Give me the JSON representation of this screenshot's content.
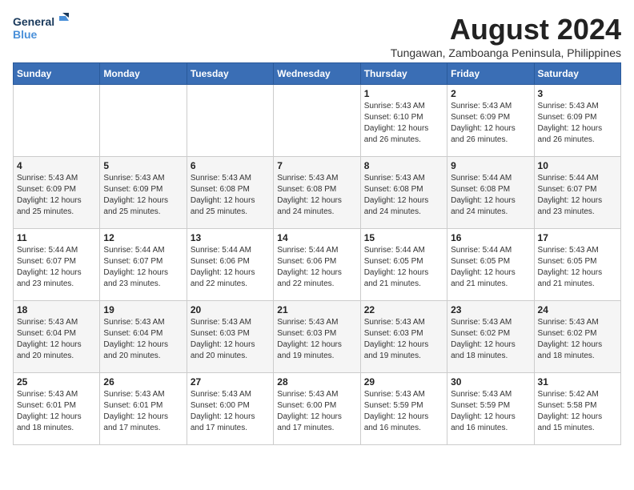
{
  "logo": {
    "line1": "General",
    "line2": "Blue"
  },
  "title": "August 2024",
  "location": "Tungawan, Zamboanga Peninsula, Philippines",
  "days_header": [
    "Sunday",
    "Monday",
    "Tuesday",
    "Wednesday",
    "Thursday",
    "Friday",
    "Saturday"
  ],
  "weeks": [
    [
      {
        "day": "",
        "info": ""
      },
      {
        "day": "",
        "info": ""
      },
      {
        "day": "",
        "info": ""
      },
      {
        "day": "",
        "info": ""
      },
      {
        "day": "1",
        "info": "Sunrise: 5:43 AM\nSunset: 6:10 PM\nDaylight: 12 hours\nand 26 minutes."
      },
      {
        "day": "2",
        "info": "Sunrise: 5:43 AM\nSunset: 6:09 PM\nDaylight: 12 hours\nand 26 minutes."
      },
      {
        "day": "3",
        "info": "Sunrise: 5:43 AM\nSunset: 6:09 PM\nDaylight: 12 hours\nand 26 minutes."
      }
    ],
    [
      {
        "day": "4",
        "info": "Sunrise: 5:43 AM\nSunset: 6:09 PM\nDaylight: 12 hours\nand 25 minutes."
      },
      {
        "day": "5",
        "info": "Sunrise: 5:43 AM\nSunset: 6:09 PM\nDaylight: 12 hours\nand 25 minutes."
      },
      {
        "day": "6",
        "info": "Sunrise: 5:43 AM\nSunset: 6:08 PM\nDaylight: 12 hours\nand 25 minutes."
      },
      {
        "day": "7",
        "info": "Sunrise: 5:43 AM\nSunset: 6:08 PM\nDaylight: 12 hours\nand 24 minutes."
      },
      {
        "day": "8",
        "info": "Sunrise: 5:43 AM\nSunset: 6:08 PM\nDaylight: 12 hours\nand 24 minutes."
      },
      {
        "day": "9",
        "info": "Sunrise: 5:44 AM\nSunset: 6:08 PM\nDaylight: 12 hours\nand 24 minutes."
      },
      {
        "day": "10",
        "info": "Sunrise: 5:44 AM\nSunset: 6:07 PM\nDaylight: 12 hours\nand 23 minutes."
      }
    ],
    [
      {
        "day": "11",
        "info": "Sunrise: 5:44 AM\nSunset: 6:07 PM\nDaylight: 12 hours\nand 23 minutes."
      },
      {
        "day": "12",
        "info": "Sunrise: 5:44 AM\nSunset: 6:07 PM\nDaylight: 12 hours\nand 23 minutes."
      },
      {
        "day": "13",
        "info": "Sunrise: 5:44 AM\nSunset: 6:06 PM\nDaylight: 12 hours\nand 22 minutes."
      },
      {
        "day": "14",
        "info": "Sunrise: 5:44 AM\nSunset: 6:06 PM\nDaylight: 12 hours\nand 22 minutes."
      },
      {
        "day": "15",
        "info": "Sunrise: 5:44 AM\nSunset: 6:05 PM\nDaylight: 12 hours\nand 21 minutes."
      },
      {
        "day": "16",
        "info": "Sunrise: 5:44 AM\nSunset: 6:05 PM\nDaylight: 12 hours\nand 21 minutes."
      },
      {
        "day": "17",
        "info": "Sunrise: 5:43 AM\nSunset: 6:05 PM\nDaylight: 12 hours\nand 21 minutes."
      }
    ],
    [
      {
        "day": "18",
        "info": "Sunrise: 5:43 AM\nSunset: 6:04 PM\nDaylight: 12 hours\nand 20 minutes."
      },
      {
        "day": "19",
        "info": "Sunrise: 5:43 AM\nSunset: 6:04 PM\nDaylight: 12 hours\nand 20 minutes."
      },
      {
        "day": "20",
        "info": "Sunrise: 5:43 AM\nSunset: 6:03 PM\nDaylight: 12 hours\nand 20 minutes."
      },
      {
        "day": "21",
        "info": "Sunrise: 5:43 AM\nSunset: 6:03 PM\nDaylight: 12 hours\nand 19 minutes."
      },
      {
        "day": "22",
        "info": "Sunrise: 5:43 AM\nSunset: 6:03 PM\nDaylight: 12 hours\nand 19 minutes."
      },
      {
        "day": "23",
        "info": "Sunrise: 5:43 AM\nSunset: 6:02 PM\nDaylight: 12 hours\nand 18 minutes."
      },
      {
        "day": "24",
        "info": "Sunrise: 5:43 AM\nSunset: 6:02 PM\nDaylight: 12 hours\nand 18 minutes."
      }
    ],
    [
      {
        "day": "25",
        "info": "Sunrise: 5:43 AM\nSunset: 6:01 PM\nDaylight: 12 hours\nand 18 minutes."
      },
      {
        "day": "26",
        "info": "Sunrise: 5:43 AM\nSunset: 6:01 PM\nDaylight: 12 hours\nand 17 minutes."
      },
      {
        "day": "27",
        "info": "Sunrise: 5:43 AM\nSunset: 6:00 PM\nDaylight: 12 hours\nand 17 minutes."
      },
      {
        "day": "28",
        "info": "Sunrise: 5:43 AM\nSunset: 6:00 PM\nDaylight: 12 hours\nand 17 minutes."
      },
      {
        "day": "29",
        "info": "Sunrise: 5:43 AM\nSunset: 5:59 PM\nDaylight: 12 hours\nand 16 minutes."
      },
      {
        "day": "30",
        "info": "Sunrise: 5:43 AM\nSunset: 5:59 PM\nDaylight: 12 hours\nand 16 minutes."
      },
      {
        "day": "31",
        "info": "Sunrise: 5:42 AM\nSunset: 5:58 PM\nDaylight: 12 hours\nand 15 minutes."
      }
    ]
  ]
}
